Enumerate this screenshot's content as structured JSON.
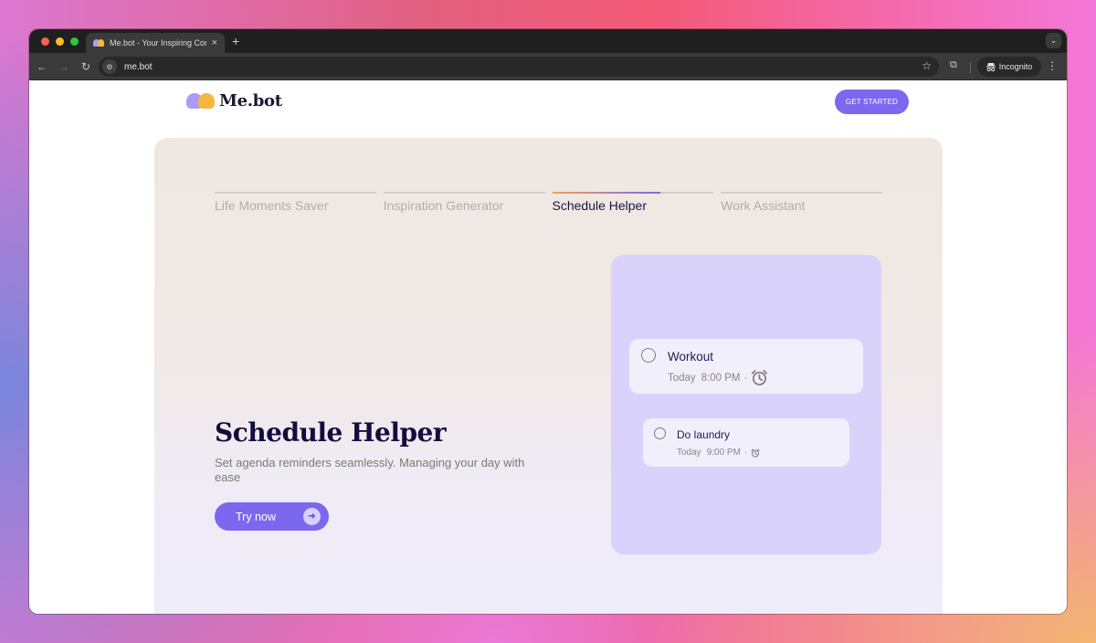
{
  "browser": {
    "tab": {
      "title": "Me.bot - Your Inspiring Companion",
      "title_visible": "Me.bot - Your Inspiring Comp",
      "close_icon": "×"
    },
    "new_tab_icon": "+",
    "tab_menu_icon": "⌄",
    "nav": {
      "back_icon": "←",
      "forward_icon": "→",
      "reload_icon": "↻"
    },
    "site_info_icon": "⚙",
    "url": "me.bot",
    "bookmark_icon": "☆",
    "extensions_icon": "⧉",
    "incognito_label": "Incognito",
    "incognito_icon": "🕶",
    "menu_icon": "⋮"
  },
  "site": {
    "logo_text": "Me.bot",
    "get_started_label": "GET STARTED"
  },
  "feature_tabs": [
    {
      "label": "Life Moments Saver",
      "active": false,
      "progress": 0
    },
    {
      "label": "Inspiration Generator",
      "active": false,
      "progress": 0
    },
    {
      "label": "Schedule Helper",
      "active": true,
      "progress": 0.67
    },
    {
      "label": "Work Assistant",
      "active": false,
      "progress": 0
    }
  ],
  "hero": {
    "title": "Schedule Helper",
    "description": "Set agenda reminders seamlessly. Managing your day with ease",
    "cta_label": "Try now",
    "cta_icon": "➜"
  },
  "demo": {
    "tasks": [
      {
        "name": "Workout",
        "day": "Today",
        "time": "8:00 PM",
        "separator": "·",
        "icon": "alarm-clock"
      },
      {
        "name": "Do laundry",
        "day": "Today",
        "time": "9:00 PM",
        "separator": "·",
        "icon": "alarm-clock"
      }
    ]
  },
  "colors": {
    "accent": "#7b68ee",
    "title_dark": "#120d3c",
    "demo_card": "#d9d2fb",
    "task_card": "#f1effc"
  }
}
